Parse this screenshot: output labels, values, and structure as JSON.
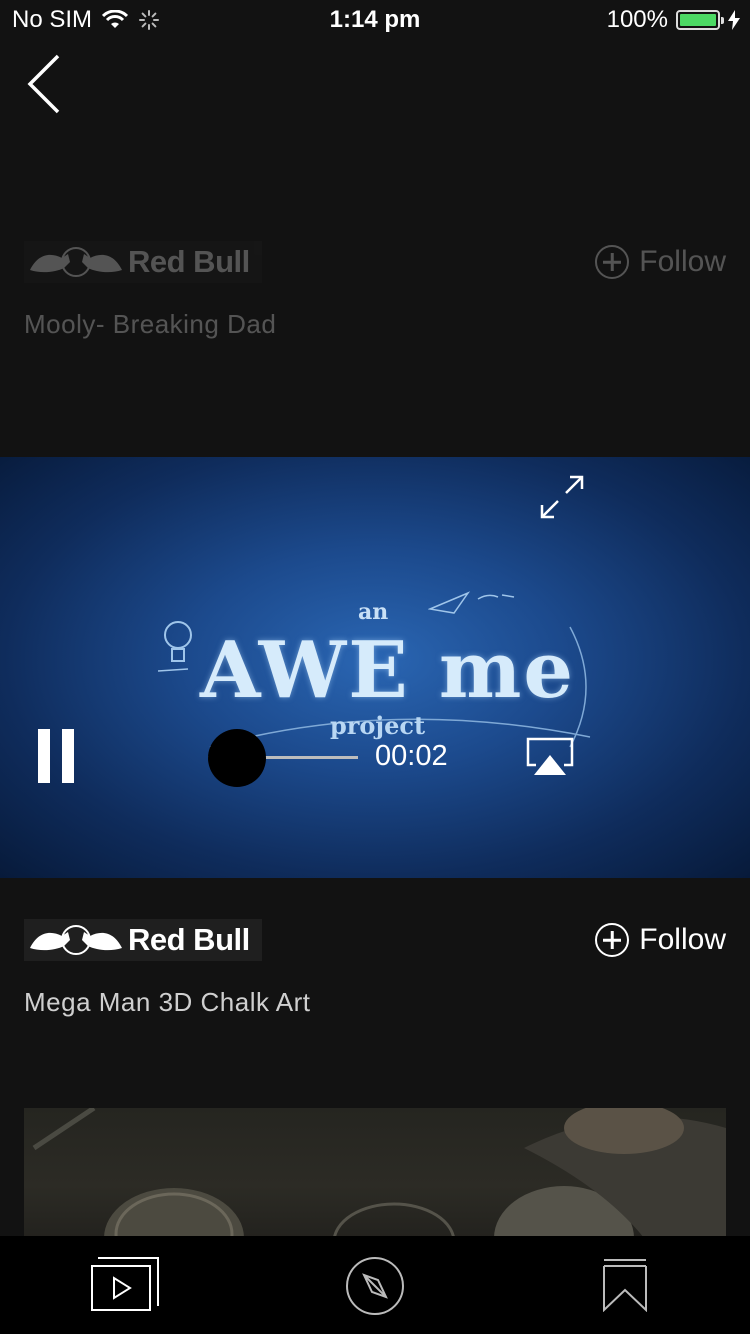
{
  "status_bar": {
    "carrier": "No SIM",
    "time": "1:14 pm",
    "battery_percent": "100%",
    "battery_level": 1.0,
    "battery_color": "#4cd964"
  },
  "nav": {
    "back_icon": "chevron-left-icon"
  },
  "feed": {
    "items": [
      {
        "brand": "Red Bull",
        "follow_label": "Follow",
        "title": "Mooly- Breaking Dad",
        "state": "faded"
      },
      {
        "brand": "Red Bull",
        "follow_label": "Follow",
        "title": "Mega Man 3D Chalk Art",
        "state": "active"
      }
    ]
  },
  "player": {
    "artwork_text_small": "an",
    "artwork_text_main": "AWE me",
    "artwork_text_sub": "project",
    "elapsed": "00:02",
    "progress": 0.0,
    "playing": true,
    "accent_color": "#1c4a8d"
  },
  "tab_bar": {
    "tabs": [
      {
        "icon": "video-feed-icon"
      },
      {
        "icon": "compass-icon"
      },
      {
        "icon": "bookmark-icon"
      }
    ]
  }
}
